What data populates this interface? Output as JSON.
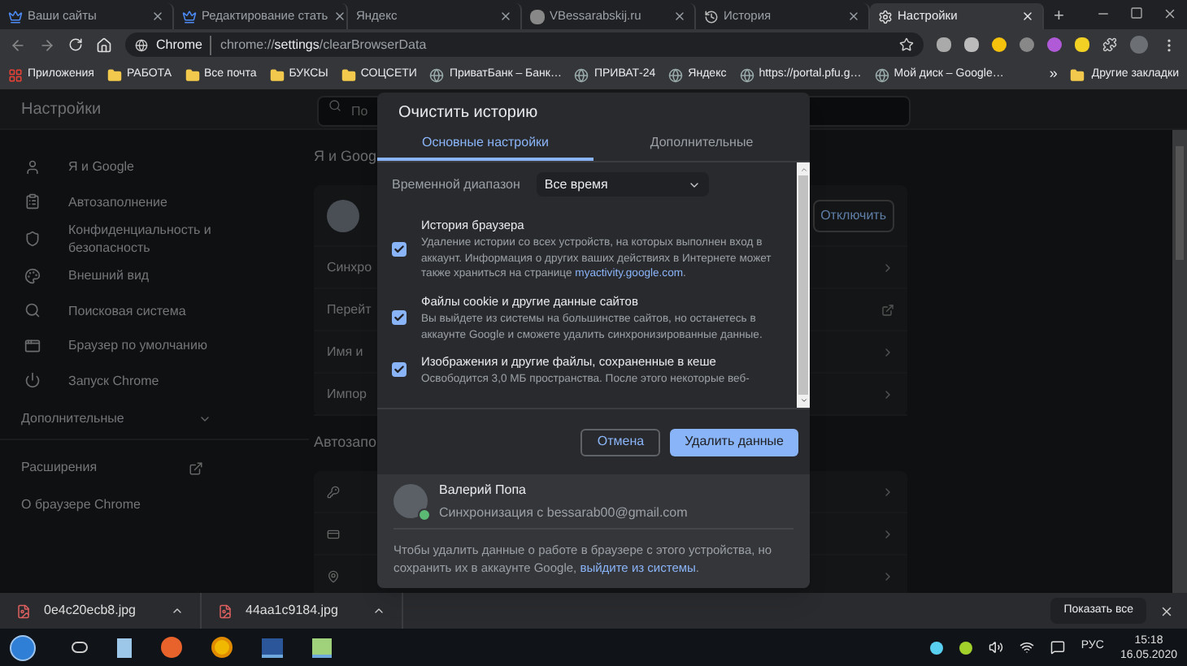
{
  "browser_tabs": [
    {
      "title": "Ваши сайты",
      "selected": false
    },
    {
      "title": "Редактирование стать",
      "selected": false
    },
    {
      "title": "Яндекс",
      "selected": false
    },
    {
      "title": "VBessarabskij.ru",
      "selected": false
    },
    {
      "title": "История",
      "selected": false
    },
    {
      "title": "Настройки",
      "selected": true
    }
  ],
  "new_tab": "+",
  "address_bar": {
    "chip": "Chrome",
    "url": "chrome://**settings**/clearBrowserData"
  },
  "bookmarks": [
    {
      "label": "Приложения",
      "kind": "apps"
    },
    {
      "label": "РАБОТА",
      "kind": "folder"
    },
    {
      "label": "Все почта",
      "kind": "folder"
    },
    {
      "label": "БУКСЫ",
      "kind": "folder"
    },
    {
      "label": "СОЦСЕТИ",
      "kind": "folder"
    },
    {
      "label": "ПриватБанк – Банк…",
      "kind": "site"
    },
    {
      "label": "ПРИВАТ-24",
      "kind": "site"
    },
    {
      "label": "Яндекс",
      "kind": "site"
    },
    {
      "label": "https://portal.pfu.g…",
      "kind": "site"
    },
    {
      "label": "Мой диск – Google…",
      "kind": "site"
    }
  ],
  "bookmarks_overflow": "»",
  "other_bookmarks": "Другие закладки",
  "settings": {
    "title": "Настройки",
    "search_placeholder": "По",
    "sidebar": [
      {
        "label": "Я и Google"
      },
      {
        "label": "Автозаполнение"
      },
      {
        "label": "Конфиденциальность и безопасность"
      },
      {
        "label": "Внешний вид"
      },
      {
        "label": "Поисковая система"
      },
      {
        "label": "Браузер по умолчанию"
      },
      {
        "label": "Запуск Chrome"
      }
    ],
    "advanced": "Дополнительные",
    "extensions": "Расширения",
    "about": "О браузере Chrome",
    "sections": [
      {
        "heading": "Я и Goog",
        "rows": [
          {
            "kind": "profile",
            "button": "Отключить"
          },
          {
            "kind": "link",
            "label": "Синхро"
          },
          {
            "kind": "external",
            "label": "Перейт"
          },
          {
            "kind": "link",
            "label": "Имя и"
          },
          {
            "kind": "link",
            "label": "Импор"
          }
        ]
      },
      {
        "heading": "Автозапо",
        "rows": [
          {
            "kind": "key"
          },
          {
            "kind": "card"
          },
          {
            "kind": "pin"
          }
        ]
      }
    ]
  },
  "dialog": {
    "title": "Очистить историю",
    "tabs": [
      {
        "label": "Основные настройки",
        "selected": true
      },
      {
        "label": "Дополнительные",
        "selected": false
      }
    ],
    "time_range_label": "Временной диапазон",
    "time_range_value": "Все время",
    "items": [
      {
        "title": "История браузера",
        "description": "Удаление истории со всех устройств, на которых выполнен вход в аккаунт. Информация о других ваших действиях в Интернете может также храниться на странице ",
        "link": "myactivity.google.com",
        "after_link": ".",
        "checked": true
      },
      {
        "title": "Файлы cookie и другие данные сайтов",
        "description": "Вы выйдете из системы на большинстве сайтов, но останетесь в аккаунте Google и сможете удалить синхронизированные данные.",
        "checked": true
      },
      {
        "title": "Изображения и другие файлы, сохраненные в кеше",
        "description": "Освободится 3,0 МБ пространства. После этого некоторые веб-",
        "checked": true
      }
    ],
    "cancel": "Отмена",
    "confirm": "Удалить данные",
    "account": {
      "name": "Валерий Попа",
      "sync": "Синхронизация с bessarab00@gmail.com"
    },
    "footer": "Чтобы удалить данные о работе в браузере с этого устройства, но сохранить их в аккаунте Google, ",
    "footer_link": "выйдите из системы",
    "footer_end": "."
  },
  "downloads": [
    {
      "file": "0e4c20ecb8.jpg"
    },
    {
      "file": "44aa1c9184.jpg"
    }
  ],
  "show_all": "Показать все",
  "taskbar": {
    "language": "РУС",
    "time": "15:18",
    "date": "16.05.2020"
  }
}
